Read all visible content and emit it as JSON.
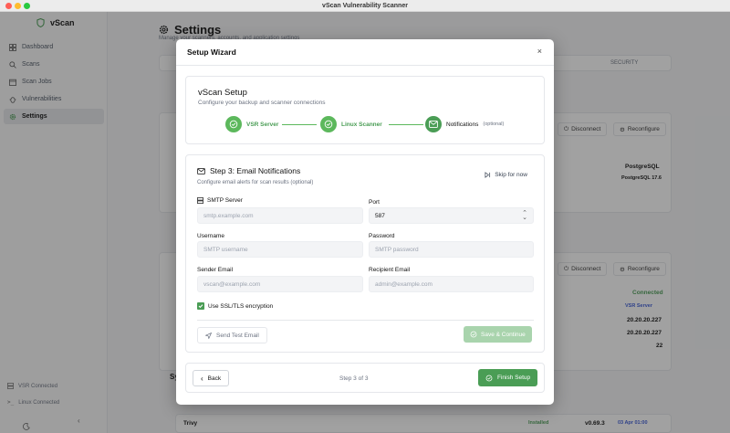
{
  "window": {
    "title": "vScan Vulnerability Scanner"
  },
  "sidebar": {
    "brand": "vScan",
    "items": [
      {
        "label": "Dashboard",
        "icon": "dashboard-icon"
      },
      {
        "label": "Scans",
        "icon": "search-icon"
      },
      {
        "label": "Scan Jobs",
        "icon": "calendar-icon"
      },
      {
        "label": "Vulnerabilities",
        "icon": "bug-icon"
      },
      {
        "label": "Settings",
        "icon": "gear-icon",
        "active": true
      }
    ],
    "status": {
      "vsr": "VSR Connected",
      "linux": "Linux Connected"
    }
  },
  "background": {
    "page_title": "Settings",
    "page_subtitle": "Manage your scanners, accounts, and application settings",
    "tab_security": "SECURITY",
    "disconnect": "Disconnect",
    "reconfigure": "Reconfigure",
    "db_type": "PostgreSQL",
    "db_version": "PostgreSQL 17.6",
    "connected": "Connected",
    "vsr_badge": "VSR Server",
    "ip1": "20.20.20.227",
    "ip2": "20.20.20.227",
    "port": "22",
    "scanner_name": "Trivy",
    "scanner_status": "Installed",
    "scanner_version": "v0.69.3",
    "scanner_date": "03 Apr 01:00",
    "section_letters": "Sy"
  },
  "modal": {
    "title": "Setup Wizard",
    "close": "×",
    "header": {
      "title": "vScan Setup",
      "subtitle": "Configure your backup and scanner connections"
    },
    "steps": [
      {
        "label": "VSR Server"
      },
      {
        "label": "Linux Scanner"
      },
      {
        "label": "Notifications",
        "optional": "(optional)"
      }
    ],
    "section": {
      "title": "Step 3: Email Notifications",
      "subtitle": "Configure email alerts for scan results (optional)",
      "skip": "Skip for now"
    },
    "form": {
      "smtp_label": "SMTP Server",
      "smtp_placeholder": "smtp.example.com",
      "port_label": "Port",
      "port_value": "587",
      "username_label": "Username",
      "username_placeholder": "SMTP username",
      "password_label": "Password",
      "password_placeholder": "SMTP password",
      "sender_label": "Sender Email",
      "sender_placeholder": "vscan@example.com",
      "recipient_label": "Recipient Email",
      "recipient_placeholder": "admin@example.com",
      "ssl_label": "Use SSL/TLS encryption",
      "test_button": "Send Test Email",
      "save_button": "Save & Continue"
    },
    "footer": {
      "back": "Back",
      "step_text": "Step 3 of 3",
      "finish": "Finish Setup"
    }
  },
  "colors": {
    "accent": "#4a9d55",
    "accent_light": "#a9d4ad"
  }
}
